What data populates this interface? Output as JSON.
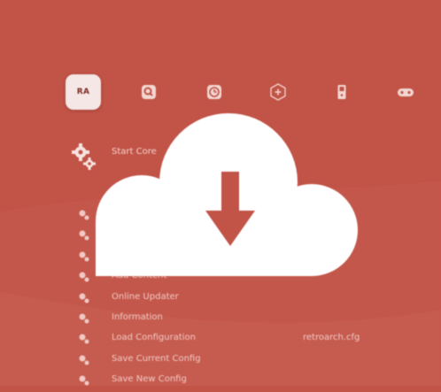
{
  "app": {
    "logo_text": "RA",
    "accent": "#c25347"
  },
  "tabs": [
    {
      "name": "main-menu",
      "icon": "retroarch-invader-icon"
    },
    {
      "name": "settings",
      "icon": "settings-icon"
    },
    {
      "name": "history",
      "icon": "history-icon"
    },
    {
      "name": "add-content",
      "icon": "add-icon"
    },
    {
      "name": "netplay",
      "icon": "device-icon"
    },
    {
      "name": "gamepad",
      "icon": "gamepad-icon"
    }
  ],
  "header": {
    "label": "Start Core"
  },
  "menu": {
    "items": [
      {
        "label": "",
        "value": ""
      },
      {
        "label": "",
        "value": ""
      },
      {
        "label": "",
        "value": ""
      },
      {
        "label": "Add Content",
        "value": ""
      },
      {
        "label": "Online Updater",
        "value": ""
      },
      {
        "label": "Information",
        "value": ""
      },
      {
        "label": "Load Configuration",
        "value": "retroarch.cfg"
      },
      {
        "label": "Save Current Config",
        "value": ""
      },
      {
        "label": "Save New Config",
        "value": ""
      }
    ]
  },
  "overlay": {
    "icon": "cloud-download-icon"
  }
}
